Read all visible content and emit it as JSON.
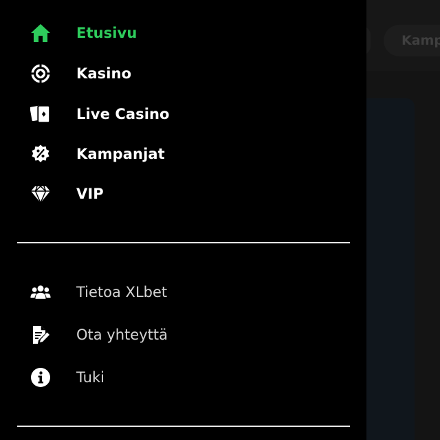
{
  "background": {
    "tab_partial_label": "Kamp"
  },
  "drawer": {
    "primary_items": [
      {
        "label": "Etusivu",
        "icon": "home-icon",
        "active": true
      },
      {
        "label": "Kasino",
        "icon": "casino-chip-icon",
        "active": false
      },
      {
        "label": "Live Casino",
        "icon": "playing-cards-icon",
        "active": false
      },
      {
        "label": "Kampanjat",
        "icon": "percent-badge-icon",
        "active": false
      },
      {
        "label": "VIP",
        "icon": "diamond-icon",
        "active": false
      }
    ],
    "secondary_items": [
      {
        "label": "Tietoa XLbet",
        "icon": "users-icon"
      },
      {
        "label": "Ota yhteyttä",
        "icon": "document-edit-icon"
      },
      {
        "label": "Tuki",
        "icon": "info-icon"
      }
    ]
  },
  "colors": {
    "accent": "#2ecc5c",
    "drawer_background": "#000000",
    "primary_text": "#ffffff",
    "secondary_text": "#d4d4d4",
    "divider": "#e6e6e6"
  }
}
